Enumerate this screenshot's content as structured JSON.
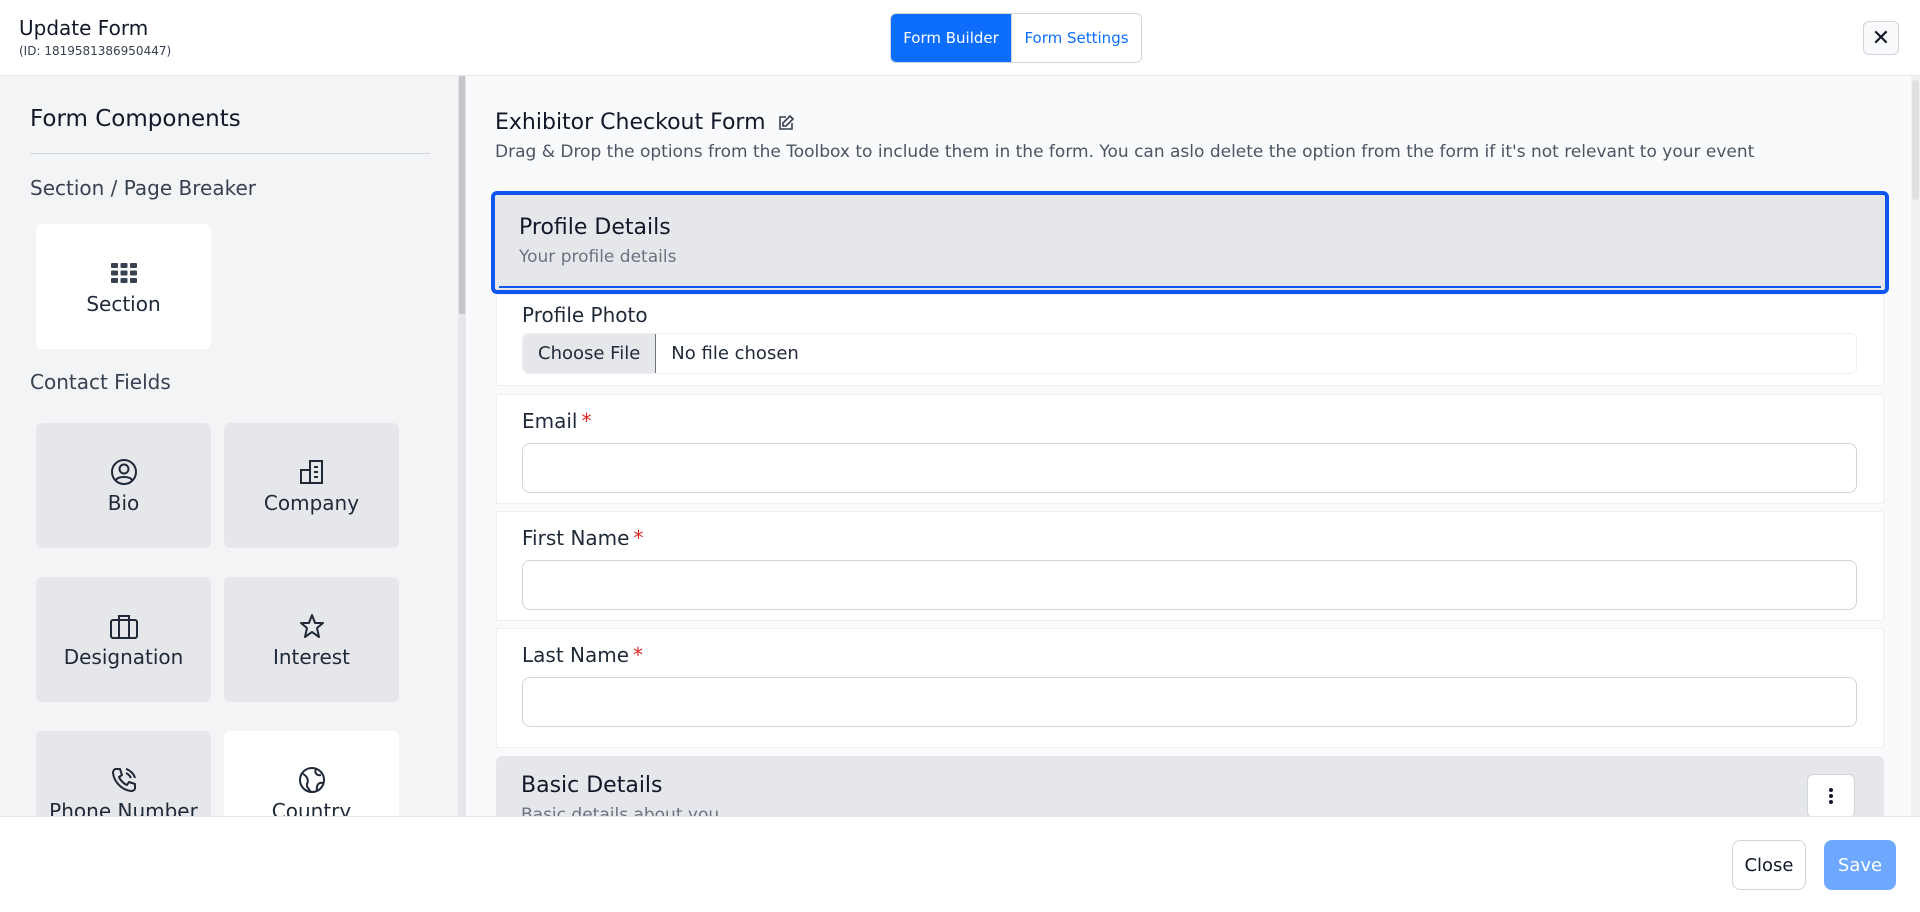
{
  "header": {
    "title": "Update Form",
    "id_text": "(ID: 1819581386950447)",
    "tabs": [
      {
        "label": "Form Builder",
        "active": true
      },
      {
        "label": "Form Settings",
        "active": false
      }
    ],
    "close_symbol": "✕"
  },
  "sidebar": {
    "title": "Form Components",
    "groups": [
      {
        "label": "Section / Page Breaker",
        "items": [
          {
            "label": "Section",
            "icon": "grid-icon"
          }
        ]
      },
      {
        "label": "Contact Fields",
        "items": [
          {
            "label": "Bio",
            "icon": "user-circle-icon"
          },
          {
            "label": "Company",
            "icon": "building-icon"
          },
          {
            "label": "Designation",
            "icon": "briefcase-icon"
          },
          {
            "label": "Interest",
            "icon": "star-icon"
          },
          {
            "label": "Phone Number",
            "icon": "phone-icon"
          },
          {
            "label": "Country",
            "icon": "globe-icon"
          }
        ]
      }
    ]
  },
  "main": {
    "form_title": "Exhibitor Checkout Form",
    "description": "Drag & Drop the options from the Toolbox to include them in the form. You can aslo delete the option from the form if it's not relevant to your event",
    "sections": [
      {
        "title": "Profile Details",
        "subtitle": "Your profile details",
        "selected": true,
        "fields": [
          {
            "label": "Profile Photo",
            "type": "file",
            "required": false,
            "button_label": "Choose File",
            "file_status": "No file chosen"
          },
          {
            "label": "Email",
            "type": "text",
            "required": true,
            "value": ""
          },
          {
            "label": "First Name",
            "type": "text",
            "required": true,
            "value": ""
          },
          {
            "label": "Last Name",
            "type": "text",
            "required": true,
            "value": ""
          }
        ]
      },
      {
        "title": "Basic Details",
        "subtitle": "Basic details about you",
        "selected": false
      }
    ],
    "required_marker": "*"
  },
  "footer": {
    "close_label": "Close",
    "save_label": "Save"
  },
  "colors": {
    "primary": "#0d6efd",
    "selection_border": "#0d57f0",
    "required": "#dc2626",
    "save_disabled": "#6ea8fe"
  }
}
